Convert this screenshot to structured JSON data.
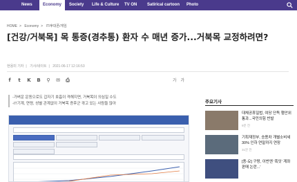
{
  "nav": {
    "items": [
      "News",
      "Economy",
      "Society",
      "Life & Culture",
      "TV ON",
      "Satirical cartoon",
      "Photo"
    ],
    "active_index": 1
  },
  "breadcrumb": {
    "home": "HOME",
    "section": "Economy",
    "subsection": "IT/후대폰/게임"
  },
  "article": {
    "headline": "[건강/거북목] 목 통증(경추통) 환자 수 매년 증가...거북목 교정하려면?",
    "byline": {
      "author": "현용미 기자",
      "email": "기사/네이트",
      "date": "2021-06-17 12:16:53"
    },
    "summary": [
      "-가벼운 운동으로도 갑자기 호흡이 격해지면, 거북목이 의심일 수도",
      "-IT기계, 연령, 성별 관계없이 거북목 증후군 겪고 있는 사람들 많아"
    ]
  },
  "share": {
    "icons": [
      "facebook-icon",
      "twitter-icon",
      "kakaotalk-icon",
      "band-icon",
      "link-icon",
      "email-icon",
      "print-icon"
    ],
    "glyphs": [
      "f",
      "t",
      "K",
      "B",
      "⚲",
      "✉",
      "⎙"
    ],
    "font_controls": [
      "가",
      "가"
    ]
  },
  "sidebar": {
    "heading": "주요기사",
    "items": [
      {
        "title": "대체공휴일법, 여당 단독 행안위 통과...국민의힘 반발",
        "time": "9분 전",
        "thumb_color": "#8a7a6a"
      },
      {
        "title": "기획재정부, 승용차 개별소비세 30% 인하 연말까지 연장",
        "time": "31분 전",
        "thumb_color": "#5b6b7b"
      },
      {
        "title": "[종-요] 구팡, 이번엔 '흑잇' 계좌 판매 논란...'",
        "time": "",
        "thumb_color": "#3f4f7f"
      }
    ]
  },
  "colors": {
    "nav_bg": "#4a3a8c",
    "accent": "#4a3a8c"
  }
}
